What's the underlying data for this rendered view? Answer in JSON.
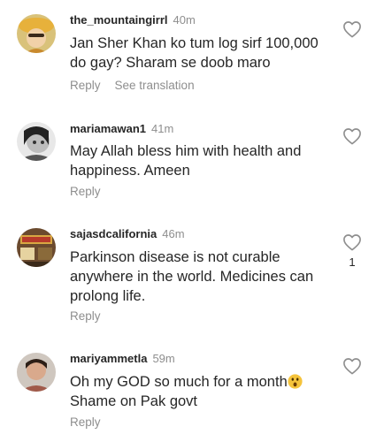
{
  "comments": [
    {
      "username": "the_mountaingirrl",
      "time": "40m",
      "text": "Jan Sher Khan ko tum log sirf 100,000 do gay? Sharam se doob maro",
      "reply_label": "Reply",
      "translate_label": "See translation",
      "avatar_icon": "avatar-yellow-hat"
    },
    {
      "username": "mariamawan1",
      "time": "41m",
      "text": "May Allah bless him with health and happiness. Ameen",
      "reply_label": "Reply",
      "avatar_icon": "avatar-bw-portrait"
    },
    {
      "username": "sajasdcalifornia",
      "time": "46m",
      "text": "Parkinson disease  is not curable anywhere in the world. Medicines can prolong life.",
      "reply_label": "Reply",
      "likes": "1",
      "avatar_icon": "avatar-shop-sign"
    },
    {
      "username": "mariyammetla",
      "time": "59m",
      "text": "Oh my GOD so much for a month",
      "text_line2": "Shame on Pak govt",
      "reply_label": "Reply",
      "avatar_icon": "avatar-person-photo",
      "emoji": "astonished-face"
    }
  ],
  "colors": {
    "text": "#262626",
    "secondary": "#8e8e8e",
    "heart_outline": "#8e8e8e"
  }
}
